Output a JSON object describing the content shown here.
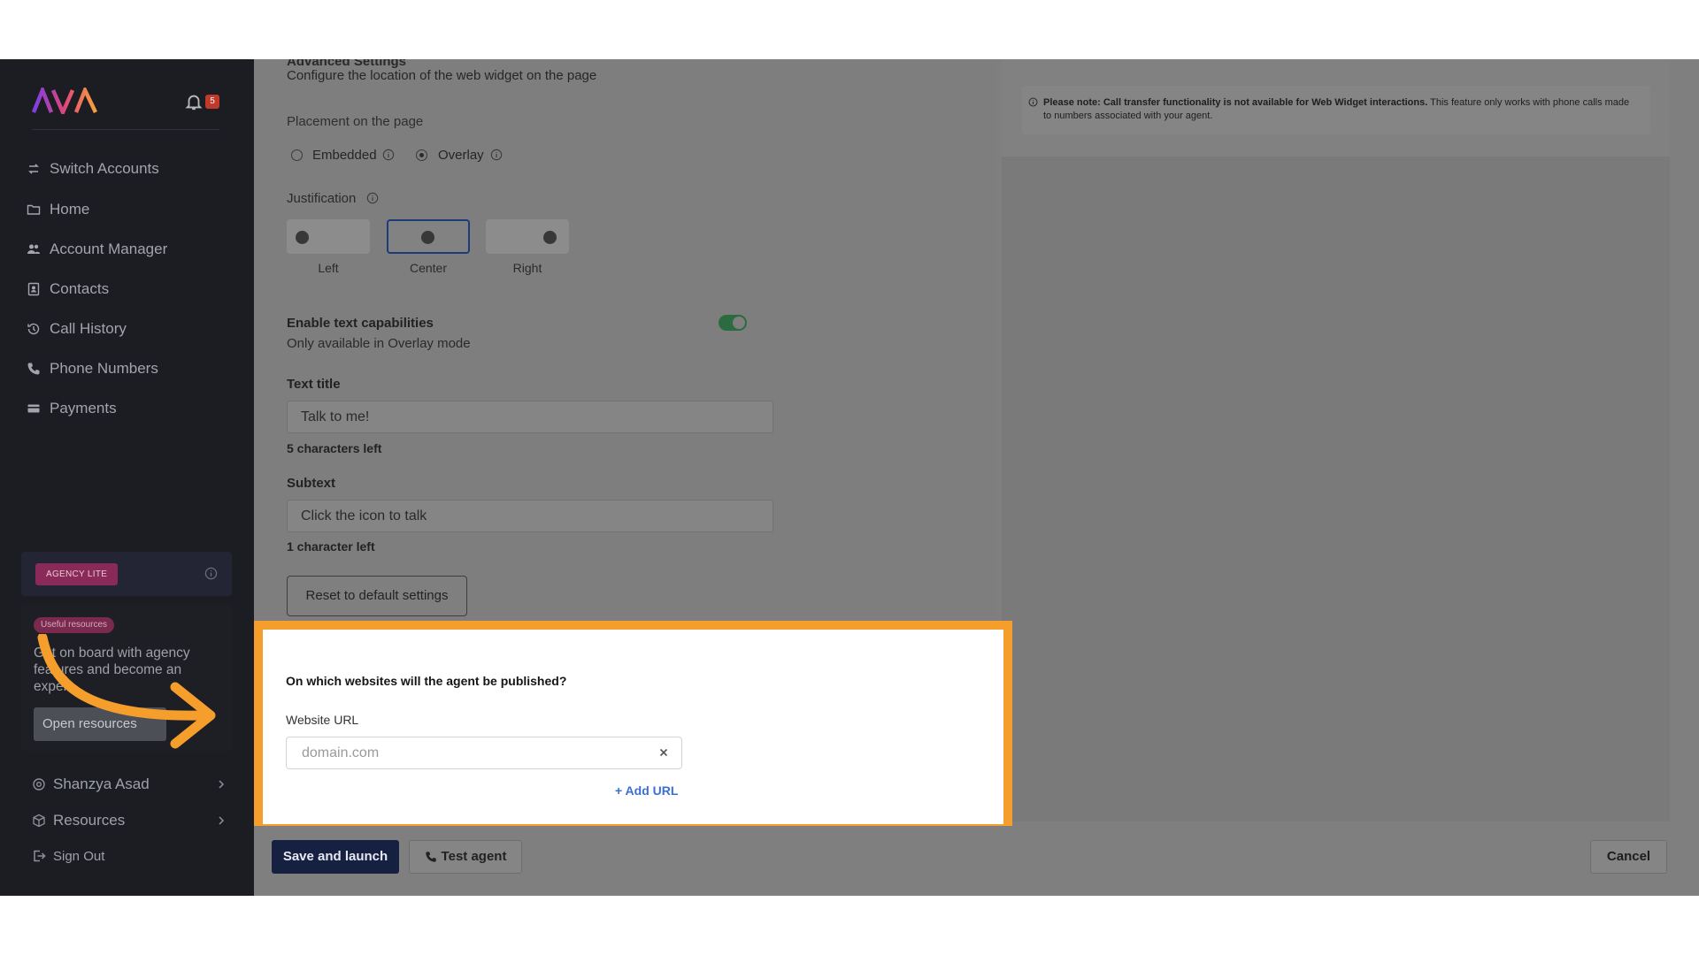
{
  "sidebar": {
    "logo_text": "AVA",
    "notification_count": "5",
    "nav": [
      {
        "label": "Switch Accounts",
        "icon": "switch-icon"
      },
      {
        "label": "Home",
        "icon": "folder-icon"
      },
      {
        "label": "Account Manager",
        "icon": "users-icon"
      },
      {
        "label": "Contacts",
        "icon": "contacts-icon"
      },
      {
        "label": "Call History",
        "icon": "history-icon"
      },
      {
        "label": "Phone Numbers",
        "icon": "phone-icon"
      },
      {
        "label": "Payments",
        "icon": "card-icon"
      }
    ],
    "plan_badge": "AGENCY LITE",
    "resources_card": {
      "badge": "Useful resources",
      "text": "Get on board with agency features and become an expert",
      "button": "Open resources"
    },
    "user_name": "Shanzya Asad",
    "resources_label": "Resources",
    "sign_out_label": "Sign Out"
  },
  "advanced": {
    "title": "Advanced Settings",
    "subtitle": "Configure the location of the web widget on the page",
    "placement_label": "Placement on the page",
    "placement_options": [
      "Embedded",
      "Overlay"
    ],
    "placement_selected": "Overlay",
    "justification_label": "Justification",
    "justification_options": [
      "Left",
      "Center",
      "Right"
    ],
    "justification_selected": "Center",
    "text_capabilities_label": "Enable text capabilities",
    "text_capabilities_sub": "Only available in Overlay mode",
    "text_capabilities_enabled": true,
    "text_title_label": "Text title",
    "text_title_value": "Talk to me!",
    "text_title_count": "5 characters left",
    "subtext_label": "Subtext",
    "subtext_value": "Click the icon to talk",
    "subtext_count": "1 character left",
    "reset_label": "Reset to default settings"
  },
  "note": {
    "bold": "Please note: Call transfer functionality is not available for Web Widget interactions.",
    "rest": " This feature only works with phone calls made to numbers associated with your agent."
  },
  "publish": {
    "question": "On which websites will the agent be published?",
    "url_label": "Website URL",
    "url_placeholder": "domain.com",
    "add_url": "+ Add URL"
  },
  "footer": {
    "save_label": "Save and launch",
    "test_label": "Test agent",
    "cancel_label": "Cancel"
  },
  "colors": {
    "highlight": "#f59e2c",
    "primary": "#162040",
    "link": "#3b6fd6",
    "toggle_on": "#2b6b3f"
  }
}
